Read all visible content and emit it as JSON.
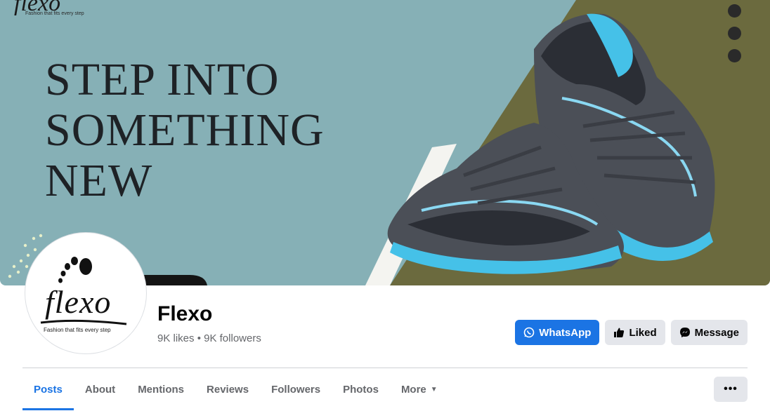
{
  "cover": {
    "headline_lines": [
      "STEP INTO",
      "SOMETHING",
      "NEW"
    ],
    "brand_mark": "flexo",
    "brand_tagline": "Fashion that fits every step",
    "colors": {
      "background": "#86b0b6",
      "panel": "#6b6a3e"
    }
  },
  "profile": {
    "avatar_logo_text": "flexo",
    "avatar_tagline": "Fashion that fits every step",
    "name": "Flexo",
    "likes": "9K likes",
    "separator": " • ",
    "followers": "9K followers"
  },
  "actions": {
    "whatsapp_label": "WhatsApp",
    "whatsapp_icon": "whatsapp-icon",
    "liked_label": "Liked",
    "liked_icon": "thumbs-up-icon",
    "message_label": "Message",
    "message_icon": "messenger-icon",
    "accent": "#1b74e4"
  },
  "tabs": [
    {
      "label": "Posts",
      "active": true
    },
    {
      "label": "About"
    },
    {
      "label": "Mentions"
    },
    {
      "label": "Reviews"
    },
    {
      "label": "Followers"
    },
    {
      "label": "Photos"
    },
    {
      "label": "More",
      "caret": "▼"
    }
  ],
  "overflow_button": {
    "label": "•••",
    "icon": "more-options-icon"
  }
}
